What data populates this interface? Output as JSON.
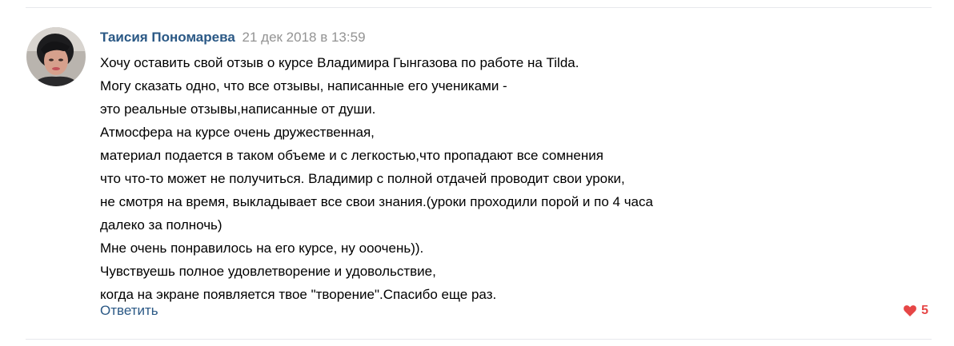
{
  "comment": {
    "author": "Таисия Пономарева",
    "date": "21 дек 2018 в 13:59",
    "lines": [
      "Хочу оставить свой отзыв о курсе Владимира Гынгазова по работе на Tilda.",
      "Могу сказать одно, что все отзывы, написанные его учениками -",
      "это реальные отзывы,написанные от души.",
      "Атмосфера на курсе очень дружественная,",
      "материал подается в таком объеме и с легкостью,что пропадают все сомнения",
      "что что-то может не получиться. Владимир с полной отдачей проводит свои уроки,",
      "не смотря на время, выкладывает все свои знания.(уроки проходили порой и по 4 часа",
      "далеко за полночь)",
      "Мне очень понравилось на его курсе, ну ооочень)).",
      "Чувствуешь полное удовлетворение и удовольствие,",
      "когда на экране появляется твое \"творение\".Спасибо еще раз."
    ],
    "reply_label": "Ответить",
    "likes_count": "5",
    "like_icon": "heart-icon"
  },
  "colors": {
    "author": "#2a5885",
    "date": "#939393",
    "text": "#000000",
    "like": "#e64646",
    "divider": "#e7e8ec"
  }
}
